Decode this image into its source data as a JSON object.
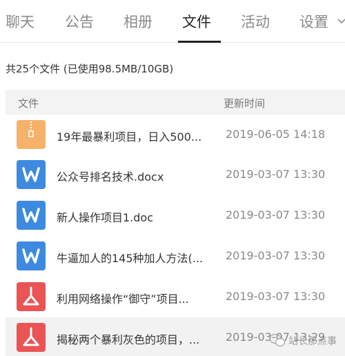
{
  "tabs": [
    {
      "label": "聊天"
    },
    {
      "label": "公告"
    },
    {
      "label": "相册"
    },
    {
      "label": "文件",
      "active": true
    },
    {
      "label": "活动"
    },
    {
      "label": "设置"
    }
  ],
  "summary": "共25个文件 (已使用98.5MB/10GB)",
  "columns": {
    "file": "文件",
    "time": "更新时间"
  },
  "files": [
    {
      "name": "19年最暴利项目，日入500...",
      "time": "2019-06-05 14:18",
      "icon": "zip-file-icon",
      "color": "#f5b26b"
    },
    {
      "name": "公众号排名技术.docx",
      "time": "2019-03-07 13:30",
      "icon": "word-file-icon",
      "color": "#3d8ae0"
    },
    {
      "name": "新人操作项目1.doc",
      "time": "2019-03-07 13:30",
      "icon": "word-file-icon",
      "color": "#3d8ae0"
    },
    {
      "name": "牛逼加人的145种加人方法(...",
      "time": "2019-03-07 13:30",
      "icon": "word-file-icon",
      "color": "#3d8ae0"
    },
    {
      "name": "利用网络操作“御守”项目...",
      "time": "2019-03-07 13:30",
      "icon": "pdf-file-icon",
      "color": "#ea5455"
    },
    {
      "name": "揭秘两个暴利灰色的项目，...",
      "time": "2019-03-07 13:29",
      "icon": "pdf-file-icon",
      "color": "#ea5455"
    }
  ],
  "watermark": "站长那点事"
}
